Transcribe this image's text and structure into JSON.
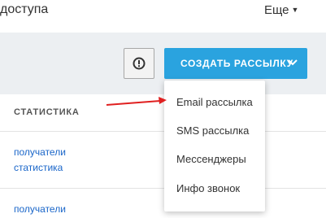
{
  "header": {
    "title": "доступа",
    "more_label": "Еще"
  },
  "toolbar": {
    "info_icon": "exclamation-circle-icon",
    "create_button_label": "СОЗДАТЬ РАССЫЛКУ",
    "create_button_icon": "chevron-down-icon"
  },
  "table": {
    "column_header": "СТАТИСТИКА",
    "rows": [
      {
        "links": [
          "получатели",
          "статистика"
        ]
      },
      {
        "links": [
          "получатели"
        ]
      }
    ]
  },
  "dropdown": {
    "items": [
      "Email рассылка",
      "SMS рассылка",
      "Мессенджеры",
      "Инфо звонок"
    ]
  },
  "annotation": {
    "arrow_color": "#e02020"
  },
  "colors": {
    "primary": "#2aa3df",
    "link": "#1a66c9",
    "toolbar_bg": "#eceff2"
  }
}
